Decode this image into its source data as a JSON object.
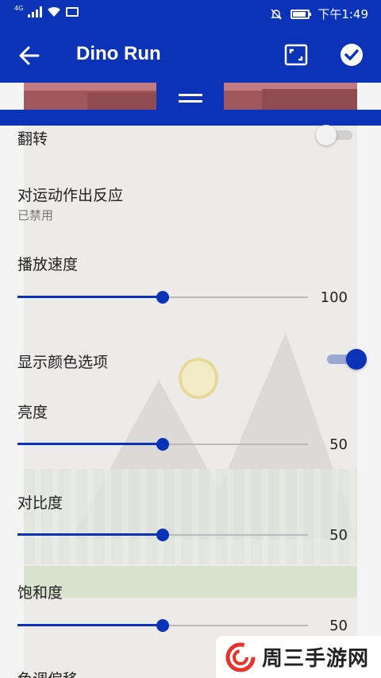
{
  "status_bar": {
    "network": "4G",
    "time": "下午1:49",
    "icons": [
      "signal-icon",
      "wifi-icon",
      "mail-icon",
      "mute-icon",
      "battery-icon"
    ]
  },
  "app_bar": {
    "title": "Dino Run",
    "icons": [
      "back-arrow-icon",
      "fullscreen-icon",
      "check-circle-icon"
    ]
  },
  "settings": {
    "flip": {
      "label": "翻转",
      "enabled": false
    },
    "motion": {
      "label": "对运动作出反应",
      "status": "已禁用"
    },
    "speed": {
      "label": "播放速度",
      "value": "100",
      "fraction": 0.5
    },
    "color_options": {
      "label": "显示颜色选项",
      "enabled": true
    },
    "brightness": {
      "label": "亮度",
      "value": "50",
      "fraction": 0.5
    },
    "contrast": {
      "label": "对比度",
      "value": "50",
      "fraction": 0.5
    },
    "saturation": {
      "label": "饱和度",
      "value": "50",
      "fraction": 0.5
    },
    "hue": {
      "label": "色调偏移"
    }
  },
  "watermark": {
    "text": "周三手游网"
  },
  "colors": {
    "primary": "#0a33b8",
    "track": "#bbbbbb",
    "background": "#f4f4f4"
  }
}
